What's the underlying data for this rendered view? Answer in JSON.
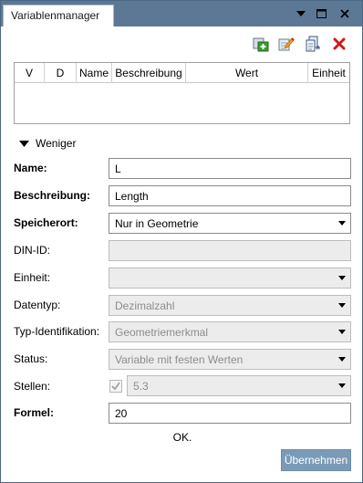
{
  "window": {
    "title": "Variablenmanager"
  },
  "grid": {
    "columns": [
      "V",
      "D",
      "Name",
      "Beschreibung",
      "Wert",
      "Einheit"
    ]
  },
  "toggle": {
    "label": "Weniger"
  },
  "form": {
    "name": {
      "label": "Name:",
      "value": "L"
    },
    "beschreibung": {
      "label": "Beschreibung:",
      "value": "Length"
    },
    "speicherort": {
      "label": "Speicherort:",
      "value": "Nur in Geometrie"
    },
    "din_id": {
      "label": "DIN-ID:",
      "value": ""
    },
    "einheit": {
      "label": "Einheit:",
      "value": ""
    },
    "datentyp": {
      "label": "Datentyp:",
      "value": "Dezimalzahl"
    },
    "typ_identifikation": {
      "label": "Typ-Identifikation:",
      "value": "Geometriemerkmal"
    },
    "status": {
      "label": "Status:",
      "value": "Variable mit festen Werten"
    },
    "stellen": {
      "label": "Stellen:",
      "value": "5.3",
      "checked": true
    },
    "formel": {
      "label": "Formel:",
      "value": "20"
    }
  },
  "footer": {
    "ok_label": "OK.",
    "apply_label": "Übernehmen"
  },
  "colors": {
    "titlebar": "#5d7894",
    "apply_button": "#7a9bb7",
    "delete_icon": "#d01818",
    "add_icon": "#3a9a2a"
  },
  "icons": [
    "add-variable-icon",
    "edit-variable-icon",
    "copy-variable-icon",
    "delete-variable-icon"
  ]
}
